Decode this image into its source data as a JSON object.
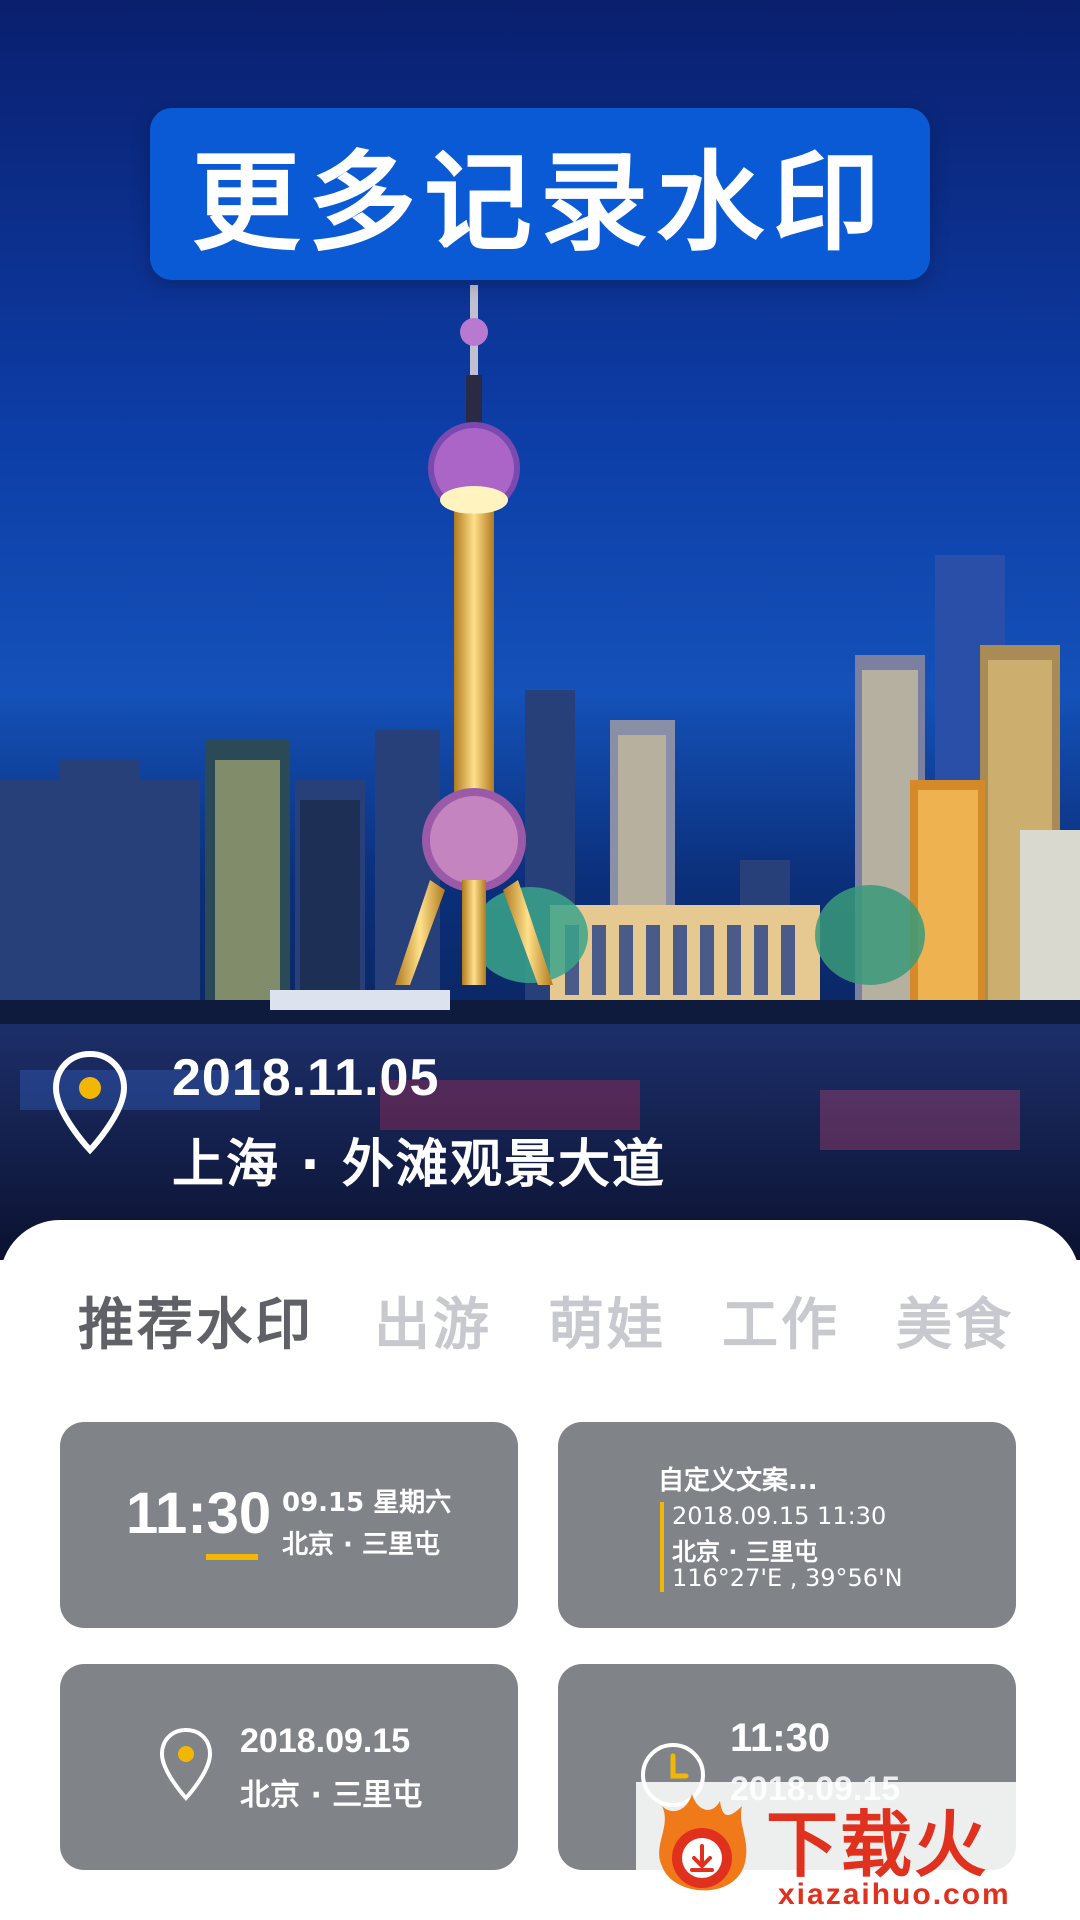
{
  "hero": {
    "title": "更多记录水印",
    "watermark": {
      "date": "2018.11.05",
      "location": "上海 · 外滩观景大道",
      "icon": "location-pin-icon"
    }
  },
  "tabs": [
    {
      "label": "推荐水印",
      "active": true
    },
    {
      "label": "出游",
      "active": false
    },
    {
      "label": "萌娃",
      "active": false
    },
    {
      "label": "工作",
      "active": false
    },
    {
      "label": "美食",
      "active": false
    }
  ],
  "templates": {
    "card1": {
      "time": "11:30",
      "date_weekday": "09.15 星期六",
      "location": "北京 · 三里屯"
    },
    "card2": {
      "title": "自定义文案...",
      "datetime": "2018.09.15  11:30",
      "location": "北京 · 三里屯",
      "coords": "116°27'E , 39°56'N"
    },
    "card3": {
      "date": "2018.09.15",
      "location": "北京 · 三里屯",
      "icon": "location-pin-icon"
    },
    "card4": {
      "time": "11:30",
      "date": "2018.09.15",
      "icon": "clock-icon"
    }
  },
  "site_watermark": {
    "name": "下载火",
    "url": "xiazaihuo.com"
  },
  "colors": {
    "banner": "#0a5ad6",
    "card": "#808489",
    "accent": "#f2b705",
    "tab_active": "#5f6166",
    "tab_inactive": "#c7c9ce",
    "logo": "#e0301e"
  }
}
